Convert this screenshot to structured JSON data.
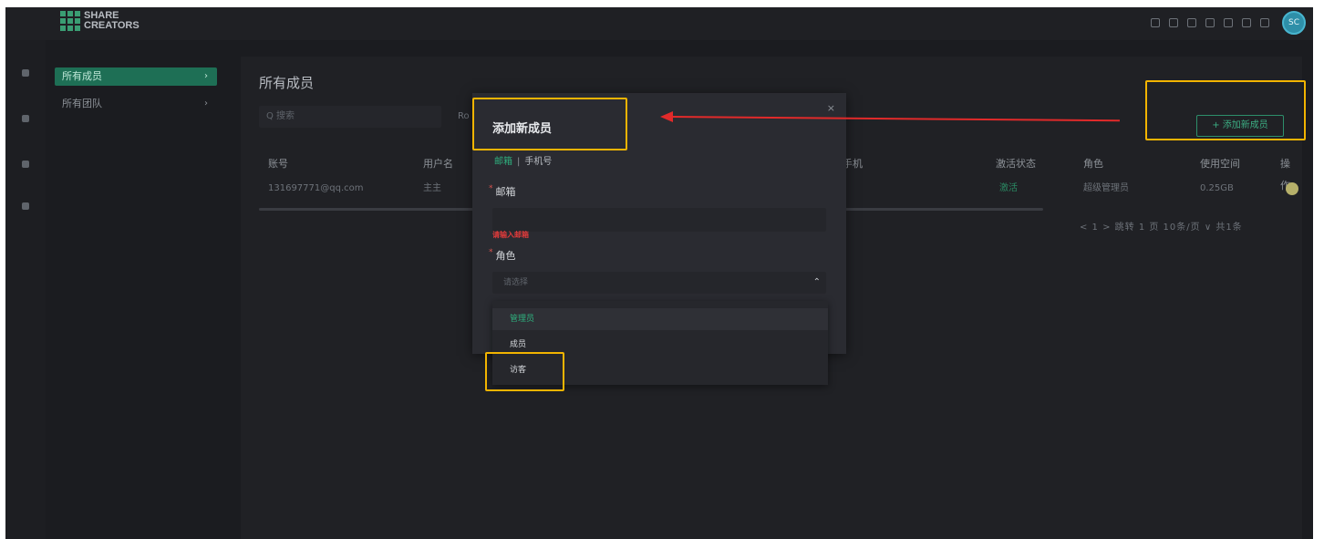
{
  "app": {
    "logo_line1": "SHARE",
    "logo_line2": "CREATORS",
    "avatar_initials": "SC"
  },
  "sidebar": {
    "items": [
      {
        "label": "所有成员",
        "active": true
      },
      {
        "label": "所有团队",
        "active": false
      }
    ]
  },
  "page": {
    "title": "所有成员",
    "search_placeholder": "Q 搜索",
    "filter_stub": "Ro",
    "add_button": "+ 添加新成员"
  },
  "table": {
    "columns": [
      "账号",
      "用户名",
      "手机",
      "激活状态",
      "角色",
      "使用空间",
      "操作"
    ],
    "rows": [
      {
        "account": "131697771@qq.com",
        "username": "主主",
        "status": "激活",
        "role": "超级管理员",
        "usage": "0.25GB"
      }
    ]
  },
  "pagination": {
    "text": "< 1 > 跳转 1 页 10条/页 ∨ 共1条"
  },
  "modal": {
    "title": "添加新成员",
    "tabs": {
      "active": "邮箱",
      "separator": "|",
      "other": "手机号"
    },
    "email_label": "邮箱",
    "email_error": "请输入邮箱",
    "role_label": "角色",
    "role_placeholder": "请选择",
    "role_options": [
      "管理员",
      "成员",
      "访客"
    ],
    "selected_option": "管理员"
  },
  "colors": {
    "accent": "#2fb07e",
    "highlight": "#f2b400",
    "arrow": "#e12a2a"
  }
}
